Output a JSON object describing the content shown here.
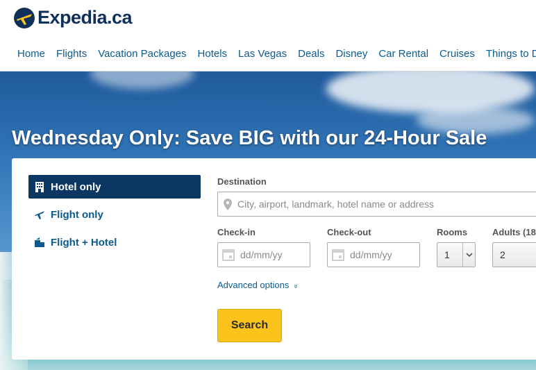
{
  "brand": {
    "logo_text": "Expedia.ca",
    "accent": "#fcc31a",
    "nav_color": "#0b5a8e",
    "dark_blue": "#0d3763"
  },
  "nav": {
    "items": [
      "Home",
      "Flights",
      "Vacation Packages",
      "Hotels",
      "Las Vegas",
      "Deals",
      "Disney",
      "Car Rental",
      "Cruises",
      "Things to Do"
    ]
  },
  "hero": {
    "headline": "Wednesday Only: Save BIG with our 24-Hour Sale"
  },
  "search": {
    "tabs": [
      {
        "label": "Hotel only",
        "icon": "hotel-icon",
        "active": true
      },
      {
        "label": "Flight only",
        "icon": "plane-icon",
        "active": false
      },
      {
        "label": "Flight + Hotel",
        "icon": "flight-hotel-icon",
        "active": false
      }
    ],
    "destination": {
      "label": "Destination",
      "placeholder": "City, airport, landmark, hotel name or address",
      "icon": "location-pin-icon"
    },
    "checkin": {
      "label": "Check-in",
      "placeholder": "dd/mm/yy",
      "icon": "calendar-icon"
    },
    "checkout": {
      "label": "Check-out",
      "placeholder": "dd/mm/yy",
      "icon": "calendar-icon"
    },
    "rooms": {
      "label": "Rooms",
      "value": "1"
    },
    "adults": {
      "label": "Adults (18",
      "value": "2"
    },
    "advanced": "Advanced options",
    "search_button": "Search"
  }
}
